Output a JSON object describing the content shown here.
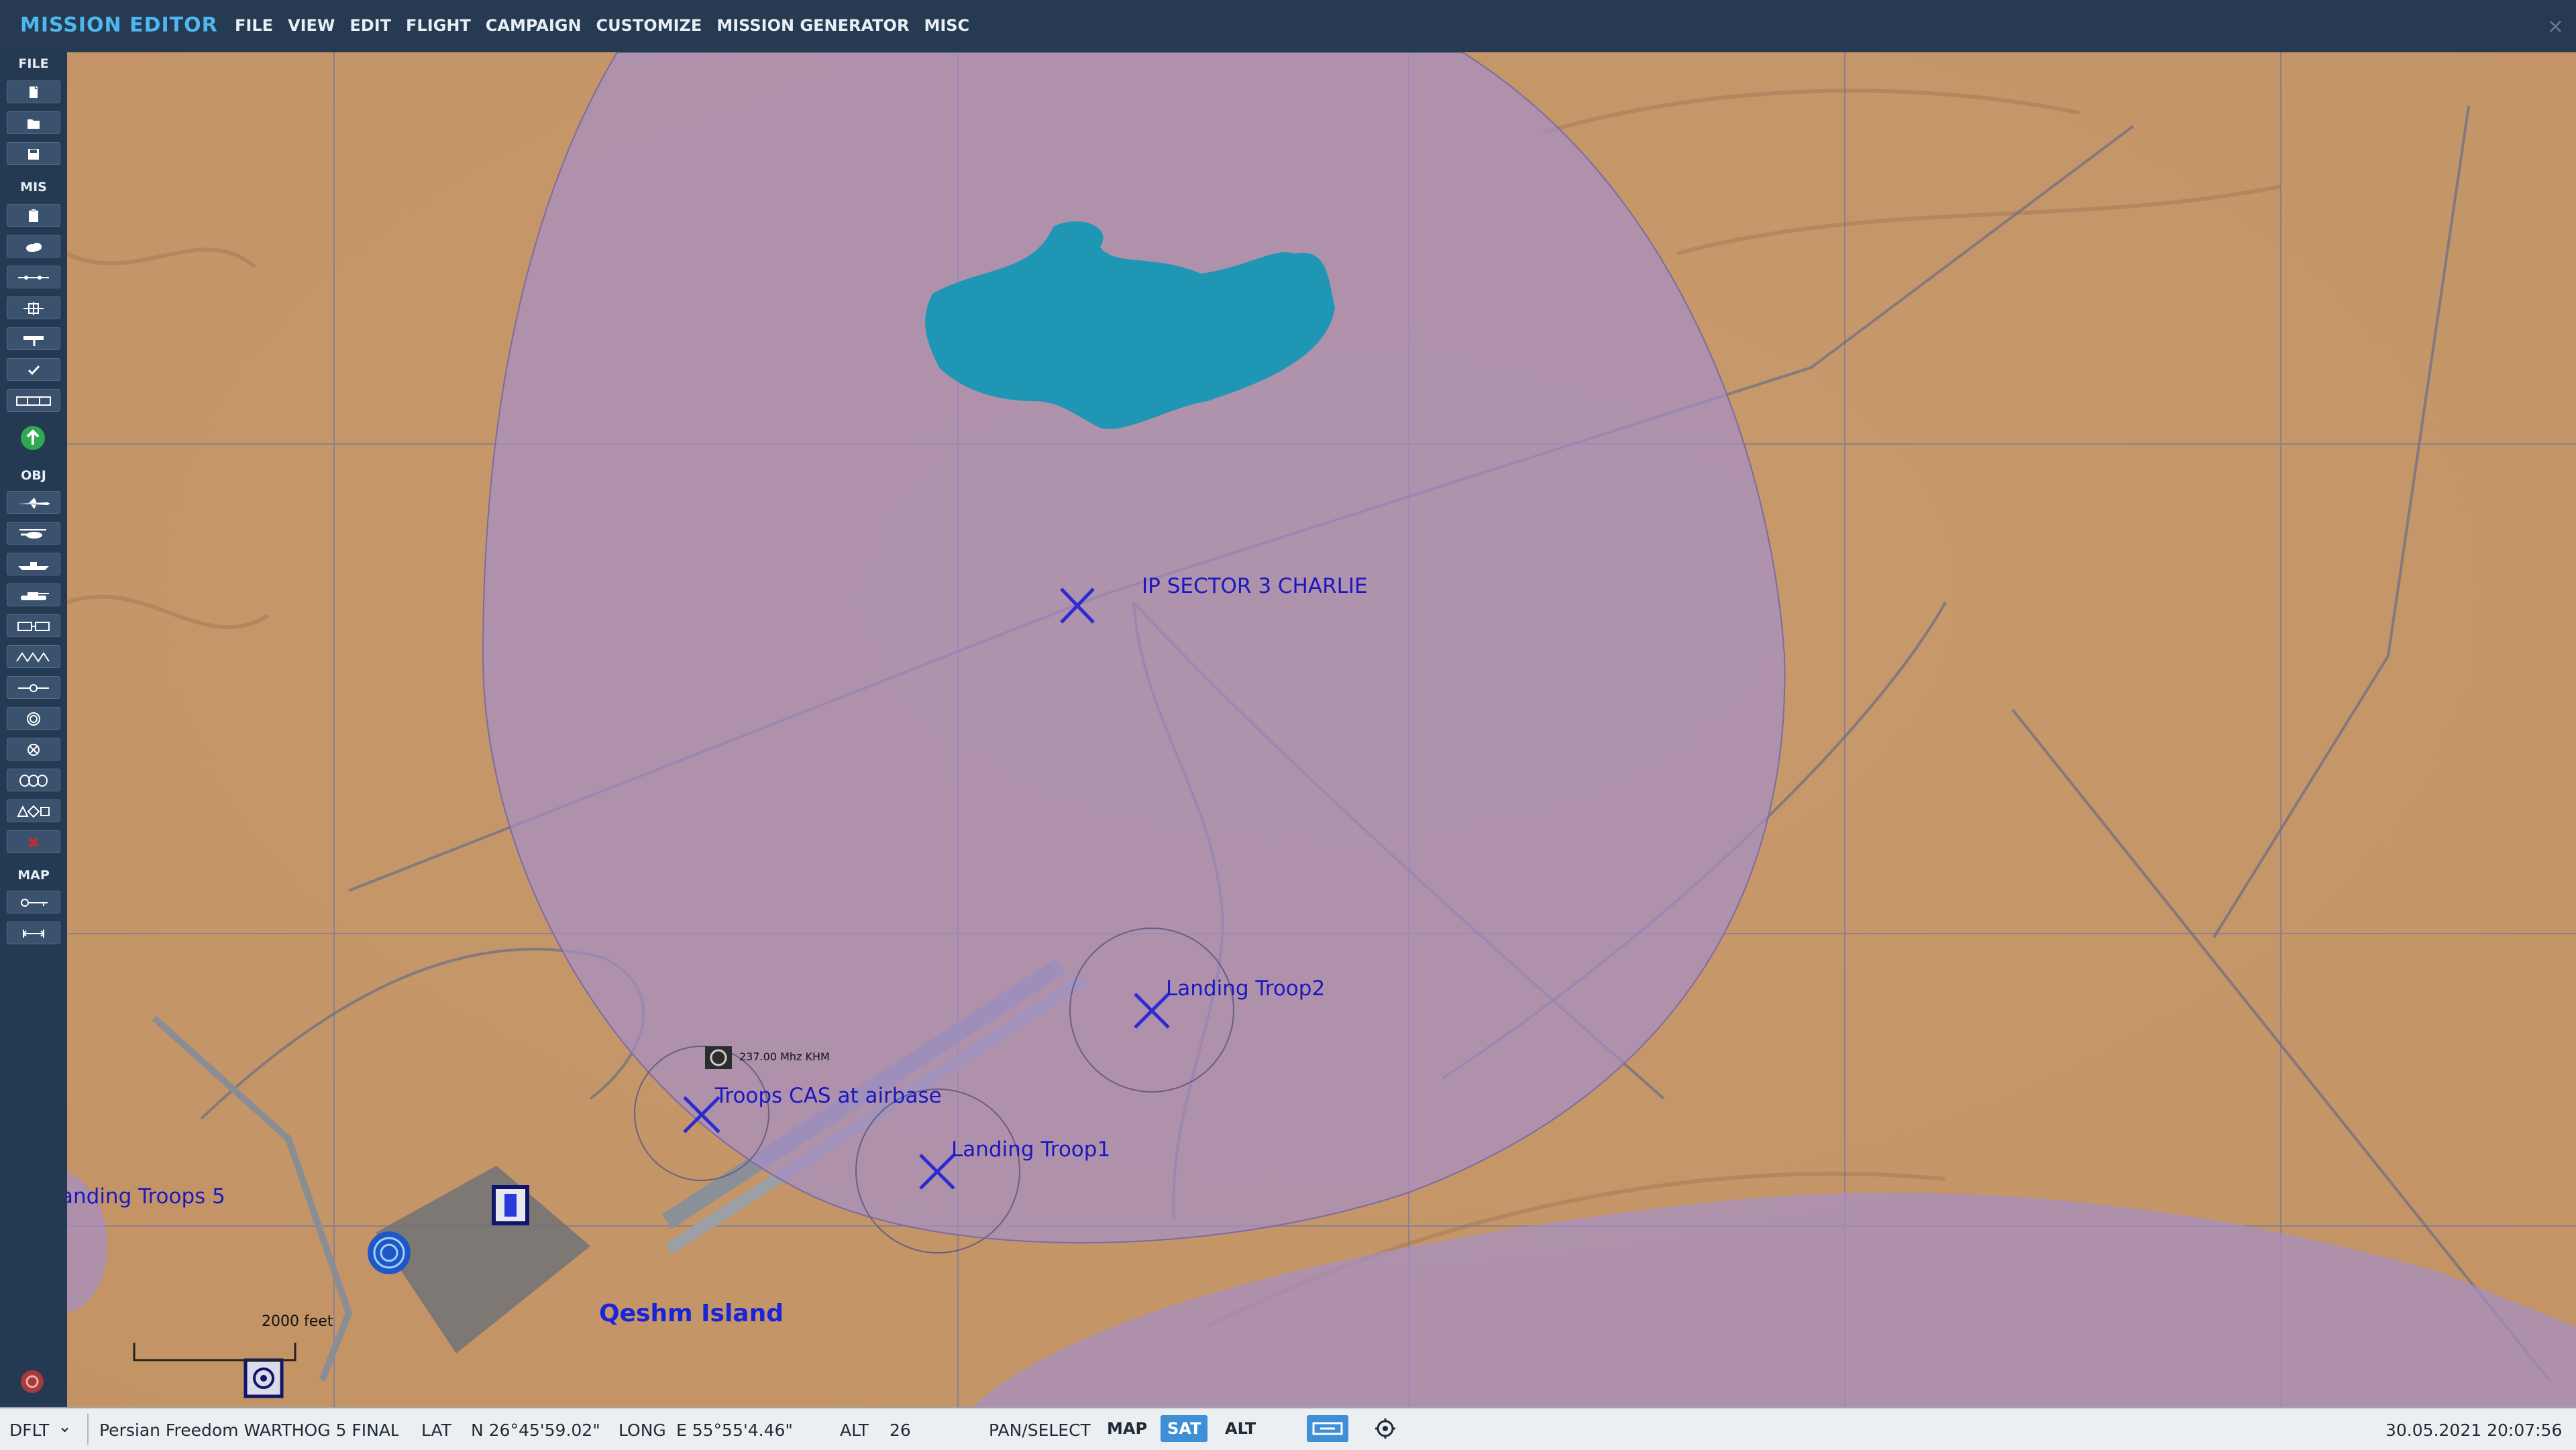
{
  "app": {
    "title": "MISSION EDITOR",
    "close_glyph": "×"
  },
  "menu": [
    "FILE",
    "VIEW",
    "EDIT",
    "FLIGHT",
    "CAMPAIGN",
    "CUSTOMIZE",
    "MISSION GENERATOR",
    "MISC"
  ],
  "toolbar": {
    "sections": {
      "file": "FILE",
      "mis": "MIS",
      "obj": "OBJ",
      "map": "MAP"
    },
    "buttons": {
      "new": "new-file-icon",
      "open": "open-folder-icon",
      "save": "save-icon",
      "briefing": "clipboard-icon",
      "weather": "cloud-icon",
      "flight_path": "route-icon",
      "coalition": "target-icon",
      "triggers": "flag-icon",
      "check": "checkmark-icon",
      "options": "panel-icon",
      "go": "green-go-icon",
      "plane": "plane-icon",
      "helicopter": "helicopter-icon",
      "ship": "ship-icon",
      "vehicle": "tank-icon",
      "static": "static-object-icon",
      "airbase": "airbase-icon",
      "waypoint": "waypoint-icon",
      "trigger_zone": "zone-icon",
      "nav_target": "nav-target-icon",
      "template": "template-icon",
      "shapes": "shapes-icon",
      "delete": "delete-icon",
      "ruler": "ruler-icon",
      "measure": "measure-icon"
    },
    "go_color": "#2fa84f",
    "delete_color": "#d42626"
  },
  "map": {
    "labels": {
      "ip_sector": "IP SECTOR 3 CHARLIE",
      "landing_troop2": "Landing Troop2",
      "troops_cas": "Troops CAS at airbase",
      "landing_troop1": "Landing Troop1",
      "landing_troops5": "anding Troops 5",
      "qeshm": "Qeshm Island",
      "freq": "237.00 Mhz KHM",
      "scale": "2000 feet"
    },
    "colors": {
      "zone_fill": "#a58ec8",
      "label_color": "#1b18c0",
      "water": "#1f97b4",
      "terrain": "#c99a68"
    }
  },
  "status": {
    "layer": "DFLT",
    "layer_chevron": "⌄",
    "mission_file": "Persian Freedom WARTHOG 5 FINAL.miz",
    "lat_label": "LAT",
    "lat_value": "N 26°45'59.02\"",
    "long_label": "LONG",
    "long_value": "E 55°55'4.46\"",
    "alt_label": "ALT",
    "alt_value": "26",
    "mode": "PAN/SELECT",
    "map_btn": "MAP",
    "sat_btn": "SAT",
    "alt_btn": "ALT",
    "datetime": "30.05.2021 20:07:56",
    "active_view": "SAT"
  }
}
